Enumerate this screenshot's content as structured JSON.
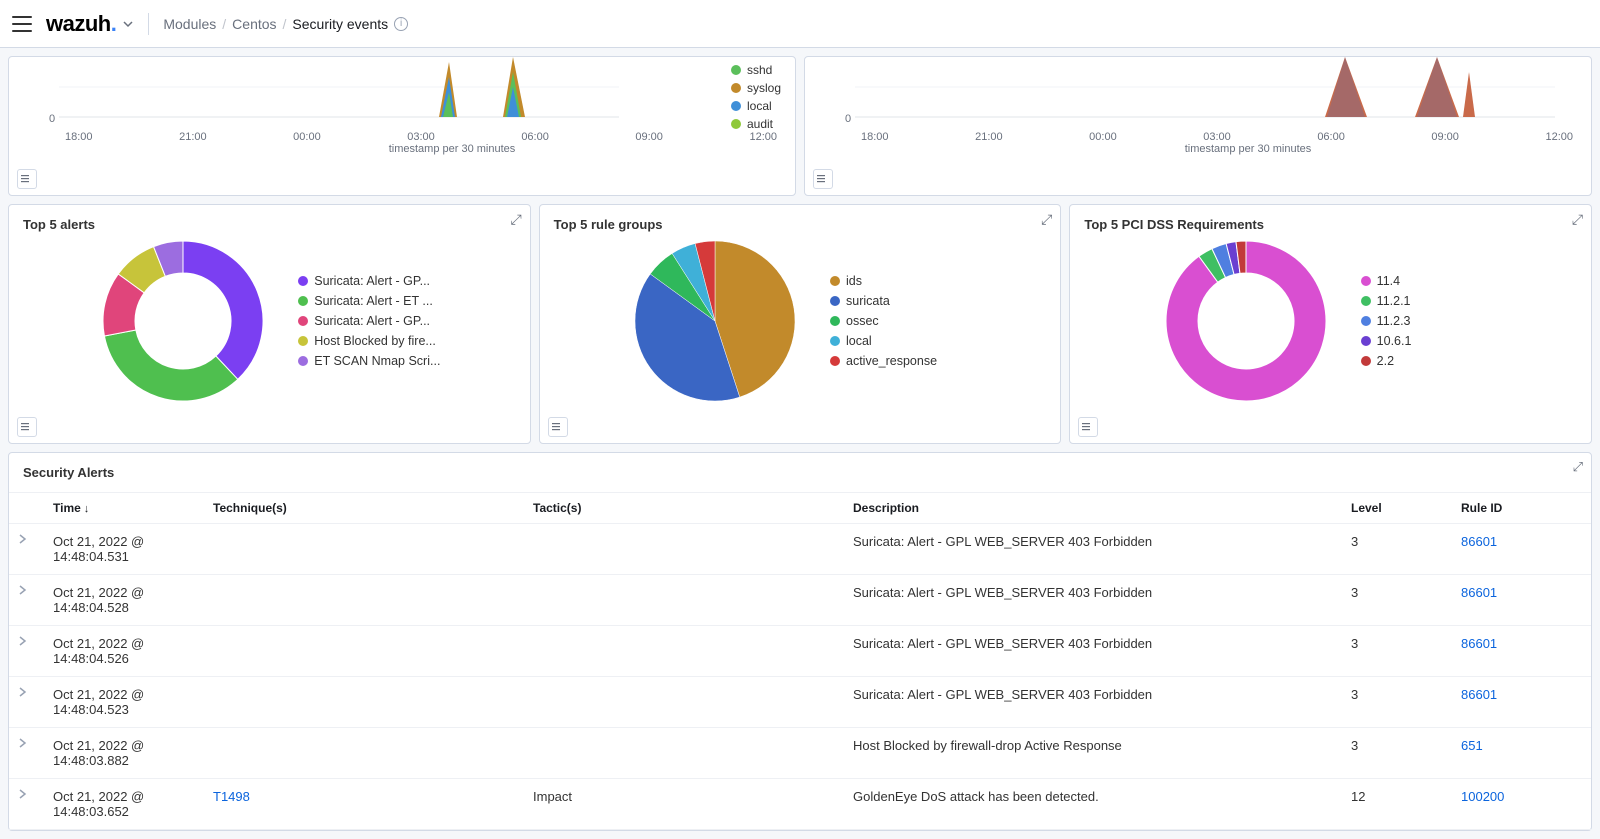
{
  "header": {
    "brand_prefix": "wazuh",
    "brand_dot": ".",
    "crumb_modules": "Modules",
    "crumb_agent": "Centos",
    "crumb_current": "Security events"
  },
  "top_area_charts": {
    "xlabel": "timestamp per 30 minutes",
    "y_zero": "0",
    "xticks": [
      "18:00",
      "21:00",
      "00:00",
      "03:00",
      "06:00",
      "09:00",
      "12:00"
    ],
    "left_legend": [
      {
        "label": "sshd",
        "color": "#5bbf5b"
      },
      {
        "label": "syslog",
        "color": "#c28a2b"
      },
      {
        "label": "local",
        "color": "#3f8fd8"
      },
      {
        "label": "audit",
        "color": "#8fc93a"
      }
    ]
  },
  "panels": {
    "top5_alerts": {
      "title": "Top 5 alerts",
      "legend": [
        {
          "label": "Suricata: Alert - GP...",
          "color": "#7b3ff2"
        },
        {
          "label": "Suricata: Alert - ET ...",
          "color": "#4fbf4f"
        },
        {
          "label": "Suricata: Alert - GP...",
          "color": "#e0457b"
        },
        {
          "label": "Host Blocked by fire...",
          "color": "#c7c43a"
        },
        {
          "label": "ET SCAN Nmap Scri...",
          "color": "#9c6de0"
        }
      ]
    },
    "top5_rule_groups": {
      "title": "Top 5 rule groups",
      "legend": [
        {
          "label": "ids",
          "color": "#c28a2b"
        },
        {
          "label": "suricata",
          "color": "#3a66c4"
        },
        {
          "label": "ossec",
          "color": "#2fb85b"
        },
        {
          "label": "local",
          "color": "#3fb0d8"
        },
        {
          "label": "active_response",
          "color": "#d53a3a"
        }
      ]
    },
    "top5_pci": {
      "title": "Top 5 PCI DSS Requirements",
      "legend": [
        {
          "label": "11.4",
          "color": "#d94fd1"
        },
        {
          "label": "11.2.1",
          "color": "#3fbf63"
        },
        {
          "label": "11.2.3",
          "color": "#4f7fe0"
        },
        {
          "label": "10.6.1",
          "color": "#6a3fd1"
        },
        {
          "label": "2.2",
          "color": "#c23a3a"
        }
      ]
    }
  },
  "chart_data": [
    {
      "type": "area",
      "name": "alert-location-evolution-left",
      "title": "",
      "xlabel": "timestamp per 30 minutes",
      "ylabel": "",
      "categories": [
        "18:00",
        "21:00",
        "00:00",
        "03:00",
        "06:00",
        "09:00",
        "12:00"
      ],
      "series": [
        {
          "name": "sshd",
          "color": "#5bbf5b"
        },
        {
          "name": "syslog",
          "color": "#c28a2b"
        },
        {
          "name": "local",
          "color": "#3f8fd8"
        },
        {
          "name": "audit",
          "color": "#8fc93a"
        }
      ],
      "note": "Only lower portion visible; spikes concentrated around 09:00–13:00."
    },
    {
      "type": "area",
      "name": "alert-location-evolution-right",
      "title": "",
      "xlabel": "timestamp per 30 minutes",
      "ylabel": "",
      "categories": [
        "18:00",
        "21:00",
        "00:00",
        "03:00",
        "06:00",
        "09:00",
        "12:00"
      ],
      "note": "Only lower portion visible; two large stacked spikes around 09:00–10:00 and 12:00–13:00."
    },
    {
      "type": "pie",
      "name": "top5-alerts-donut",
      "title": "Top 5 alerts",
      "series": [
        {
          "name": "Suricata: Alert - GP...",
          "value": 38,
          "color": "#7b3ff2"
        },
        {
          "name": "Suricata: Alert - ET ...",
          "value": 34,
          "color": "#4fbf4f"
        },
        {
          "name": "Suricata: Alert - GP...",
          "value": 13,
          "color": "#e0457b"
        },
        {
          "name": "Host Blocked by fire...",
          "value": 9,
          "color": "#c7c43a"
        },
        {
          "name": "ET SCAN Nmap Scri...",
          "value": 6,
          "color": "#9c6de0"
        }
      ],
      "donut": true
    },
    {
      "type": "pie",
      "name": "top5-rule-groups-pie",
      "title": "Top 5 rule groups",
      "series": [
        {
          "name": "ids",
          "value": 45,
          "color": "#c28a2b"
        },
        {
          "name": "suricata",
          "value": 40,
          "color": "#3a66c4"
        },
        {
          "name": "ossec",
          "value": 6,
          "color": "#2fb85b"
        },
        {
          "name": "local",
          "value": 5,
          "color": "#3fb0d8"
        },
        {
          "name": "active_response",
          "value": 4,
          "color": "#d53a3a"
        }
      ],
      "donut": false
    },
    {
      "type": "pie",
      "name": "top5-pci-donut",
      "title": "Top 5 PCI DSS Requirements",
      "series": [
        {
          "name": "11.4",
          "value": 90,
          "color": "#d94fd1"
        },
        {
          "name": "11.2.1",
          "value": 3,
          "color": "#3fbf63"
        },
        {
          "name": "11.2.3",
          "value": 3,
          "color": "#4f7fe0"
        },
        {
          "name": "10.6.1",
          "value": 2,
          "color": "#6a3fd1"
        },
        {
          "name": "2.2",
          "value": 2,
          "color": "#c23a3a"
        }
      ],
      "donut": true
    }
  ],
  "alerts_table": {
    "title": "Security Alerts",
    "columns": {
      "time": "Time",
      "techniques": "Technique(s)",
      "tactics": "Tactic(s)",
      "description": "Description",
      "level": "Level",
      "rule_id": "Rule ID"
    },
    "rows": [
      {
        "time": "Oct 21, 2022 @ 14:48:04.531",
        "techniques": "",
        "tactics": "",
        "description": "Suricata: Alert - GPL WEB_SERVER 403 Forbidden",
        "level": "3",
        "rule_id": "86601"
      },
      {
        "time": "Oct 21, 2022 @ 14:48:04.528",
        "techniques": "",
        "tactics": "",
        "description": "Suricata: Alert - GPL WEB_SERVER 403 Forbidden",
        "level": "3",
        "rule_id": "86601"
      },
      {
        "time": "Oct 21, 2022 @ 14:48:04.526",
        "techniques": "",
        "tactics": "",
        "description": "Suricata: Alert - GPL WEB_SERVER 403 Forbidden",
        "level": "3",
        "rule_id": "86601"
      },
      {
        "time": "Oct 21, 2022 @ 14:48:04.523",
        "techniques": "",
        "tactics": "",
        "description": "Suricata: Alert - GPL WEB_SERVER 403 Forbidden",
        "level": "3",
        "rule_id": "86601"
      },
      {
        "time": "Oct 21, 2022 @ 14:48:03.882",
        "techniques": "",
        "tactics": "",
        "description": "Host Blocked by firewall-drop Active Response",
        "level": "3",
        "rule_id": "651"
      },
      {
        "time": "Oct 21, 2022 @ 14:48:03.652",
        "techniques": "T1498",
        "tactics": "Impact",
        "description": "GoldenEye DoS attack has been detected.",
        "level": "12",
        "rule_id": "100200"
      }
    ]
  }
}
